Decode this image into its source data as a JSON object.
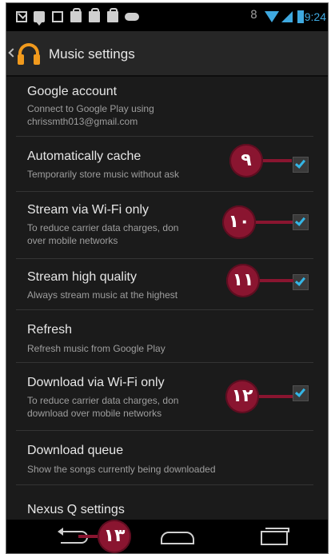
{
  "status_bar": {
    "time": "9:24",
    "bluetooth_glyph": "8",
    "icons": [
      "gmail-icon",
      "talk-icon",
      "document-icon",
      "play-store-icon",
      "play-store-icon",
      "play-store-icon",
      "game-controller-icon",
      "bluetooth-icon",
      "wifi-icon",
      "signal-icon",
      "battery-icon"
    ],
    "accent": "#3fa9e0"
  },
  "action_bar": {
    "title": "Music settings",
    "icon": "headphones-icon",
    "icon_color": "#f19a1d"
  },
  "settings": [
    {
      "title": "Google account",
      "subtitle": "Connect to Google Play using\nchrissmth013@gmail.com",
      "checkbox": false
    },
    {
      "title": "Automatically cache",
      "subtitle": "Temporarily store music without ask",
      "checkbox": true,
      "checked": true
    },
    {
      "title": "Stream via Wi-Fi only",
      "subtitle": "To reduce carrier data charges, don\nover mobile networks",
      "checkbox": true,
      "checked": true
    },
    {
      "title": "Stream high quality",
      "subtitle": "Always stream music at the highest",
      "checkbox": true,
      "checked": true
    },
    {
      "title": "Refresh",
      "subtitle": "Refresh music from Google Play",
      "checkbox": false
    },
    {
      "title": "Download via Wi-Fi only",
      "subtitle": "To reduce carrier data charges, don\ndownload over mobile networks",
      "checkbox": true,
      "checked": true
    },
    {
      "title": "Download queue",
      "subtitle": "Show the songs currently being downloaded",
      "checkbox": false
    },
    {
      "title": "Nexus Q settings",
      "subtitle": "",
      "checkbox": false
    }
  ],
  "callouts": {
    "c9": "٩",
    "c10": "١٠",
    "c11": "١١",
    "c12": "١٢",
    "c13": "١٣",
    "color": "#8a1530"
  },
  "checkbox_color": "#34b5e5",
  "nav_bar": {
    "icons": [
      "back-icon",
      "home-icon",
      "recent-apps-icon"
    ]
  }
}
